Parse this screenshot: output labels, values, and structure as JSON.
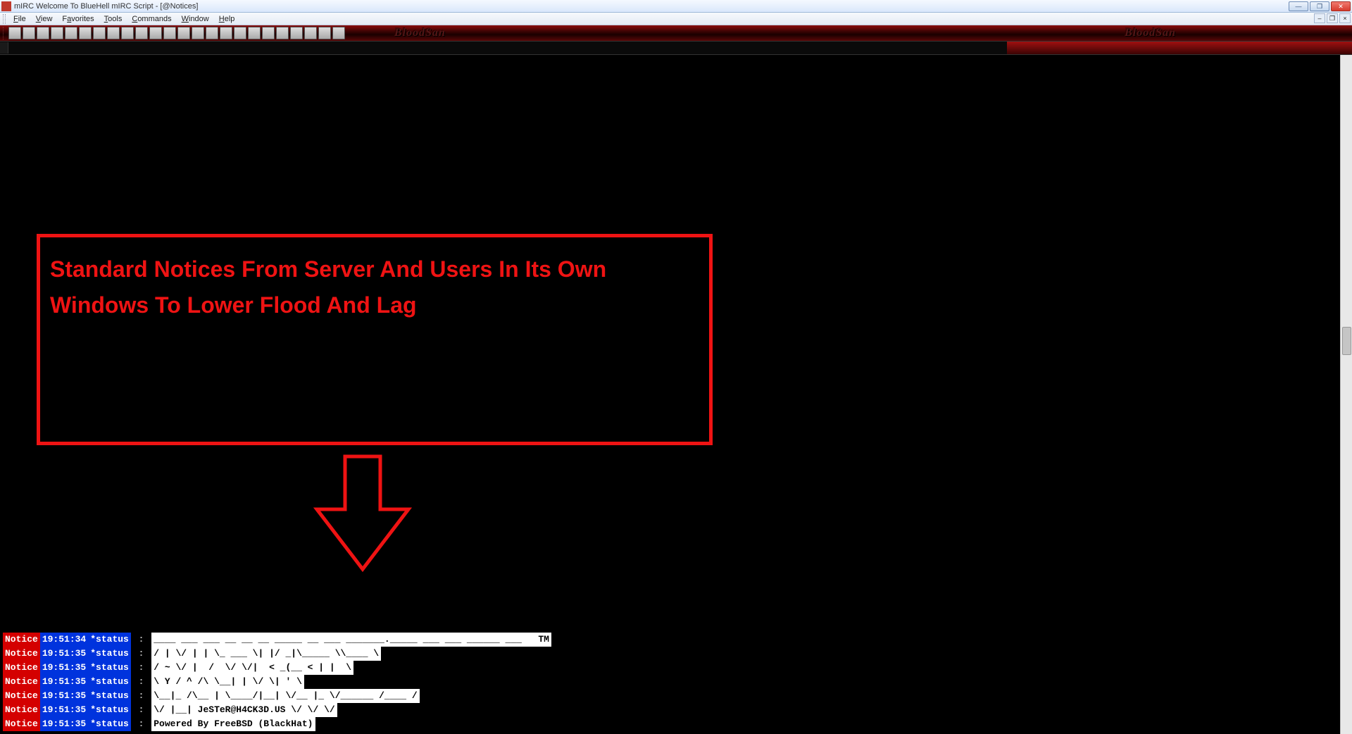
{
  "titlebar": {
    "title": "mIRC Welcome To BlueHell mIRC Script - [@Notices]"
  },
  "menu": {
    "items": [
      "File",
      "View",
      "Favorites",
      "Tools",
      "Commands",
      "Window",
      "Help"
    ]
  },
  "toolbar": {
    "brand": "BloodSan"
  },
  "annotation": {
    "text": "Standard Notices From Server And Users In Its Own Windows To Lower Flood And Lag"
  },
  "log": {
    "notice_label": "Notice",
    "status_label": "*status",
    "rows": [
      {
        "time": "19:51:34",
        "msg": "____ ___ ___ __ __ __ _____ __ ___ _______._____ ___ ___ ______ ___   TM"
      },
      {
        "time": "19:51:35",
        "msg": "/ | \\/ | | \\_ ___ \\| |/ _|\\_____ \\\\____ \\"
      },
      {
        "time": "19:51:35",
        "msg": "/ ~ \\/ |  /  \\/ \\/|  < _(__ < | |  \\"
      },
      {
        "time": "19:51:35",
        "msg": "\\ Y / ^ /\\ \\__| | \\/ \\| ' \\"
      },
      {
        "time": "19:51:35",
        "msg": "\\__|_ /\\__ | \\____/|__| \\/__ |_ \\/______ /____ /"
      },
      {
        "time": "19:51:35",
        "msg": "\\/ |__| JeSTeR@H4CK3D.US \\/ \\/ \\/"
      },
      {
        "time": "19:51:35",
        "msg": "Powered By FreeBSD (BlackHat)"
      }
    ]
  }
}
